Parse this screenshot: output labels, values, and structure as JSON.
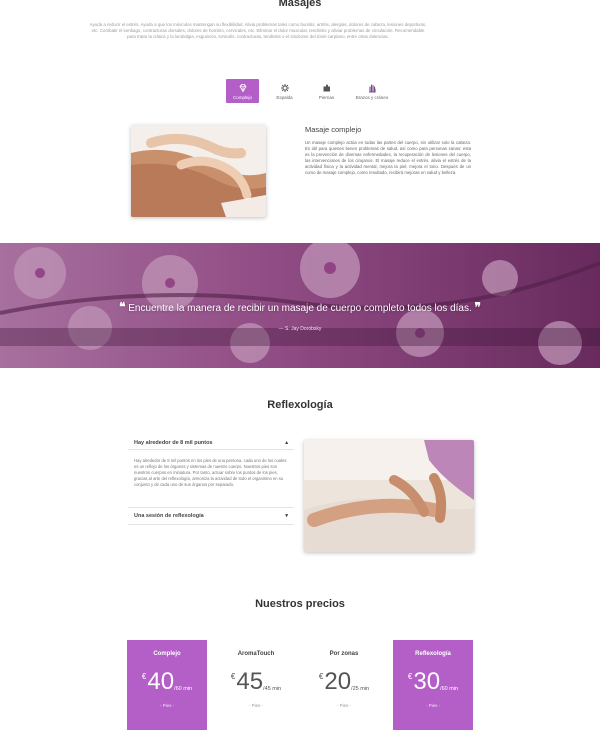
{
  "masajes": {
    "title": "Masajes",
    "intro": "Ayuda a reducir el estrés. Ayuda a que los músculos mantengan su flexibilidad. Alivia problemas tales como bursitis, artritis, alergias, dolores de cabeza, lesiones deportivas, etc. Combatir el lumbago, contracturas dorsales, dolores de hombro, cervicales, etc. Eliminar el dolor muscular, tendinitis y aliviar problemas de circulación. Recomendable para tratar la ciática y la lumbalgia, esguinces, torticolis, contracturas, tendinitis o el síndrome del túnel carpiano, entre otras dolencias.",
    "tabs": [
      {
        "label": "Complejo",
        "icon": "diamond-icon"
      },
      {
        "label": "Espalda",
        "icon": "gear-icon"
      },
      {
        "label": "Piernas",
        "icon": "puzzle-icon"
      },
      {
        "label": "Brazos y cráneo",
        "icon": "hand-icon"
      }
    ],
    "detail_title": "Masaje complejo",
    "detail_body": "Un masaje complejo actúa en todas las partes del cuerpo, sin utilizar solo la cabeza. Es útil para quienes tienen problemas de salud, así como para personas sanas: esta es la prevención de diversas enfermedades, la recuperación de lesiones del cuerpo, las intervenciones de los cirujanos. El masaje reduce el estrés, alivia el estrés de la actividad física y la actividad mental, mejora la piel, mejora el tono. Después de un curso de masaje complejo, como resultado, recibirá mejoras en salud y belleza."
  },
  "quote": {
    "text": "Encuentre la manera de recibir un masaje de cuerpo completo todos los días.",
    "open_mark": "❝",
    "close_mark": "❞",
    "author": "— S. Jay Dorobsky"
  },
  "reflexologia": {
    "title": "Reflexología",
    "items": [
      {
        "title": "Hay alrededor de 8 mil puntos",
        "chevron": "▴",
        "body": "Hay alrededor de 8 mil puntos en los pies de una persona, cada uno de los cuales es un reflejo de los órganos y sistemas de nuestro cuerpo. Nuestros pies son nuestros cuerpos en miniatura. Por tanto, actuar sobre los puntos de los pies, gracias al arte del reflexología, armoniza la actividad de todo el organismo en su conjunto y de cada uno de sus órganos por separado."
      },
      {
        "title": "Una sesión de reflexología",
        "chevron": "▾"
      }
    ]
  },
  "precios": {
    "title": "Nuestros precios",
    "cards": [
      {
        "name": "Complejo",
        "currency": "€",
        "amount": "40",
        "per": "/60 min",
        "footer": "- Pies -",
        "highlight": true
      },
      {
        "name": "AromaTouch",
        "currency": "€",
        "amount": "45",
        "per": "/45 min",
        "footer": "- Pies -",
        "highlight": false
      },
      {
        "name": "Por zonas",
        "currency": "€",
        "amount": "20",
        "per": "/25 min",
        "footer": "- Pies -",
        "highlight": false
      },
      {
        "name": "Reflexología",
        "currency": "€",
        "amount": "30",
        "per": "/60 min",
        "footer": "- Pies -",
        "highlight": true
      }
    ]
  },
  "colors": {
    "accent": "#b45ec8",
    "banner": "#8a3f7e"
  }
}
